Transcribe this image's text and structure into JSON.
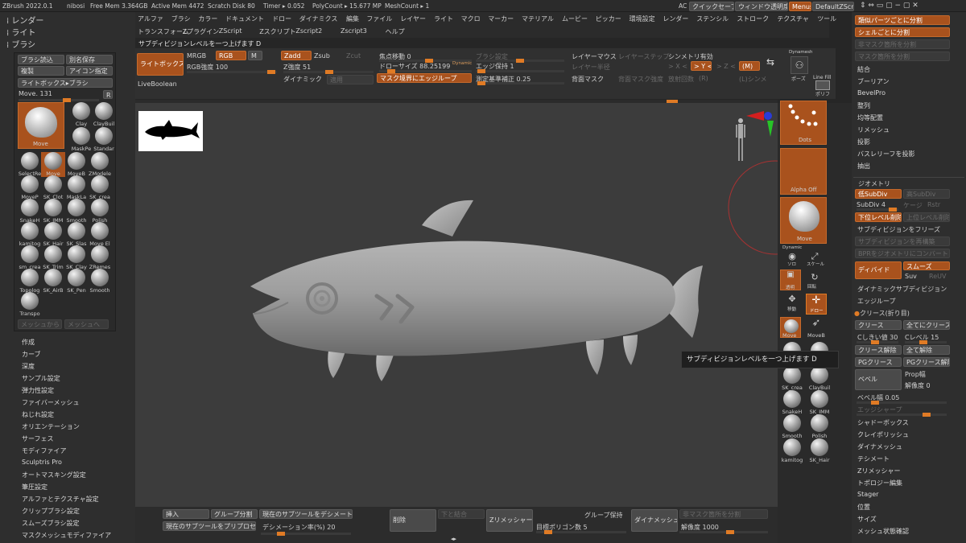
{
  "titlebar": {
    "app": "ZBrush 2022.0.1",
    "user": "nibosi",
    "free_mem": "Free Mem 3.364GB",
    "active_mem": "Active Mem 4472",
    "scratch": "Scratch Disk 80",
    "timer": "Timer ▸ 0.052",
    "polycount": "PolyCount ▸ 15.677 MP",
    "meshcount": "MeshCount ▸ 1",
    "ac": "AC",
    "quicksave": "クイックセーブ",
    "window_transparency": "ウィンドウ透明度",
    "menus": "Menus",
    "script": "DefaultZScript"
  },
  "left_header": {
    "render": "レンダー",
    "light": "ライト",
    "brush": "ブラシ"
  },
  "menubar": {
    "row1": [
      "アルファ",
      "ブラシ",
      "カラー",
      "ドキュメント",
      "ドロー",
      "ダイナミクス",
      "編集",
      "ファイル",
      "レイヤー",
      "ライト",
      "マクロ",
      "マーカー",
      "マテリアル",
      "ムービー",
      "ピッカー",
      "環境設定",
      "レンダー",
      "ステンシル",
      "ストローク",
      "テクスチャ",
      "ツール"
    ],
    "row2": [
      "トランスフォーム",
      "Zプラグイン",
      "ZScript",
      "Zスクリプト",
      "Zscript2",
      "Zscript3",
      "ヘルプ"
    ],
    "hint": "サブディビジョンレベルを一つ上げます D"
  },
  "brush_panel": {
    "load": "ブラシ読込",
    "save_as": "別名保存",
    "clone": "複製",
    "icon_set": "アイコン指定",
    "lightbox_brush": "ライトボックス▸ブラシ",
    "current": "Move. 131",
    "r": "R",
    "current_name": "Move",
    "mesh_from": "メッシュから",
    "mesh_to": "メッシュへ",
    "tools": [
      "Clay",
      "ClayBuil",
      "MaskPe",
      "Standar",
      "SelectRe",
      "Move",
      "MoveB",
      "ZModele",
      "MoveP",
      "SK_Clot",
      "MaskLa",
      "SK_crea",
      "SnakeH",
      "SK_IMM",
      "Smooth",
      "Polish",
      "kamitog",
      "SK_Hair",
      "SK_Slas",
      "Move El",
      "sm_crea",
      "SK_Trim",
      "SK_Clay",
      "ZRemes",
      "Topolog",
      "SK_AirB",
      "SK_Pen",
      "Smooth",
      "Transpo"
    ]
  },
  "left_menu": [
    "作成",
    "カーブ",
    "深度",
    "サンプル設定",
    "弾力性設定",
    "ファイバーメッシュ",
    "ねじれ設定",
    "オリエンテーション",
    "サーフェス",
    "モディファイア",
    "Sculptris Pro",
    "オートマスキング設定",
    "筆圧設定",
    "アルファとテクスチャ設定",
    "クリップブラシ設定",
    "スムーズブラシ設定",
    "マスクメッシュモディファイア"
  ],
  "toolbar": {
    "lightbox": "ライトボックス",
    "liveboolean": "LiveBoolean",
    "mrgb": "MRGB",
    "rgb": "RGB",
    "m": "M",
    "rgb_intensity": "RGB強度 100",
    "zadd": "Zadd",
    "zsub": "Zsub",
    "zcut": "Zcut",
    "z_intensity": "Z強度 51",
    "dynamic": "ダイナミック",
    "apply": "適用",
    "focal_shift": "焦点移動 0",
    "draw_size": "ドローサイズ 88.25199",
    "dynamic_small": "Dynamic",
    "mask_edgeloop": "マスク境界にエッジループ",
    "brush_settings": "ブラシ設定",
    "edge_keep": "エッジ保持 1",
    "measure_scale": "測定基準補正 0.25",
    "layer_mouse": "レイヤーマウス",
    "layer_step": "レイヤーステップ",
    "layer_size": "レイヤー半径",
    "back_mask": "背面マスク",
    "back_mask_intensity": "背面マスク強度",
    "symmetry": "シンメトリ有効",
    "sym_x": "> X <",
    "sym_y": "> Y <",
    "sym_z": "> Z <",
    "sym_m": "(M)",
    "sym_r": "(R)",
    "radial_count": "放射回数",
    "local_sym": "(L)シンメ",
    "dynamesh_label": "Dynamesh",
    "pose": "ポーズ",
    "linefill": "Line Fill",
    "polyf": "ポリフ"
  },
  "shelf": {
    "dots": "Dots",
    "alpha_off": "Alpha Off",
    "move": "Move",
    "dynamic": "Dynamic",
    "solo": "ソロ",
    "scale": "スケール",
    "transparent": "透明",
    "rotate": "回転",
    "move2": "移動",
    "nav": "ドロー",
    "move_btn": "Move",
    "moveb": "MoveB",
    "tools": [
      "SK_Clot",
      "MaskLa",
      "SK_crea",
      "ClayBuil",
      "SnakeH",
      "SK_IMM",
      "Smooth",
      "Polish",
      "kamitog",
      "SK_Hair"
    ]
  },
  "tooltip": "サブディビジョンレベルを一つ上げます D",
  "right_panel": {
    "split_similar": "類似パーツごとに分割",
    "split_shell": "シェルごとに分割",
    "split_unmasked": "非マスク箇所を分割",
    "split_masked": "マスク箇所を分割",
    "items_top": [
      "結合",
      "ブーリアン",
      "BevelPro",
      "整列",
      "均等配置",
      "リメッシュ",
      "投影",
      "バスレリーフを投影",
      "抽出"
    ],
    "geometry": "ジオメトリ",
    "lower_subdiv": "低SubDiv",
    "higher_subdiv": "高SubDiv",
    "subdiv_level": "SubDiv 4",
    "cage": "ケージ",
    "rstr": "Rstr",
    "del_lower": "下位レベル削除",
    "del_higher": "上位レベル削除",
    "freeze_subdiv": "サブディビジョンをフリーズ",
    "rebuild_subdiv": "サブディビジョンを再構築",
    "convert_bpr": "BPRをジオメトリにコンバート",
    "divide": "ディバイド",
    "smooth": "スムーズ",
    "suv": "Suv",
    "reuv": "ReUV",
    "dynamic_subdiv": "ダイナミックサブディビジョン",
    "edgeloop": "エッジループ",
    "crease_header": "クリース(折り目)",
    "crease": "クリース",
    "crease_all": "全てにクリース",
    "crease_threshold": "Cしきい値 30",
    "crease_level": "Cレベル 15",
    "uncrease": "クリース解除",
    "uncrease_all": "全て解除",
    "pg_crease": "PGクリース",
    "pg_uncrease": "PGクリース解除",
    "bevel": "ベベル",
    "prop_width": "Prop幅",
    "resolution": "解像度 0",
    "bevel_width": "ベベル幅 0.05",
    "edge_sharp": "エッジシャープ",
    "items_bottom": [
      "シャドーボックス",
      "クレイポリッシュ",
      "ダイナメッシュ",
      "テシメート",
      "Zリメッシャー",
      "トポロジー編集",
      "Stager",
      "位置",
      "サイズ",
      "メッシュ状態確認"
    ]
  },
  "bottombar": {
    "insert": "挿入",
    "group_split": "グループ分割",
    "decimate_current": "現在のサブツールをデシメート",
    "preprocess_current": "現在のサブツールをプリプロセス",
    "decimation_percent": "デシメーション率(%) 20",
    "delete": "削除",
    "merge_down": "下と結合",
    "zremesher": "Zリメッシャー",
    "keep_groups": "グループ保持",
    "target_poly": "目標ポリゴン数 5",
    "dynamesh": "ダイナメッシュ",
    "split_unmasked": "非マスク箇所を分割",
    "resolution": "解像度 1000"
  }
}
